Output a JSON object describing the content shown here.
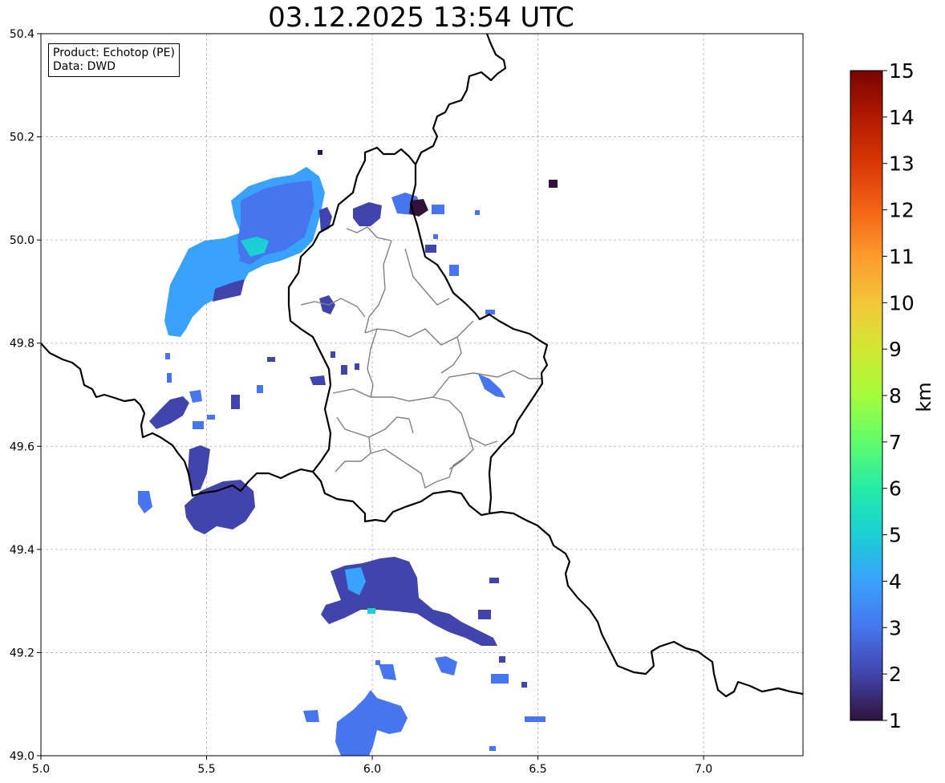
{
  "title": "03.12.2025 13:54 UTC",
  "info": {
    "product": "Product: Echotop (PE)",
    "data": "Data: DWD"
  },
  "map": {
    "x_range": [
      5.0,
      7.3
    ],
    "y_range": [
      49.0,
      50.4
    ],
    "x_ticks": [
      "5.0",
      "5.5",
      "6.0",
      "6.5",
      "7.0"
    ],
    "y_ticks": [
      "49.0",
      "49.2",
      "49.4",
      "49.6",
      "49.8",
      "50.0",
      "50.2",
      "50.4"
    ],
    "grid": true
  },
  "colorbar": {
    "label": "km",
    "min": 1,
    "max": 15,
    "ticks": [
      "1",
      "2",
      "3",
      "4",
      "5",
      "6",
      "7",
      "8",
      "9",
      "10",
      "11",
      "12",
      "13",
      "14",
      "15"
    ],
    "colormap": "turbo"
  },
  "colors": {
    "echo_low": "#30123b",
    "echo_2": "#4145ab",
    "echo_3": "#4675ed",
    "echo_4": "#39a2fc",
    "echo_5": "#1bcfd4",
    "border": "#000000",
    "internal_border": "#808080",
    "grid": "#b0b0b0"
  }
}
